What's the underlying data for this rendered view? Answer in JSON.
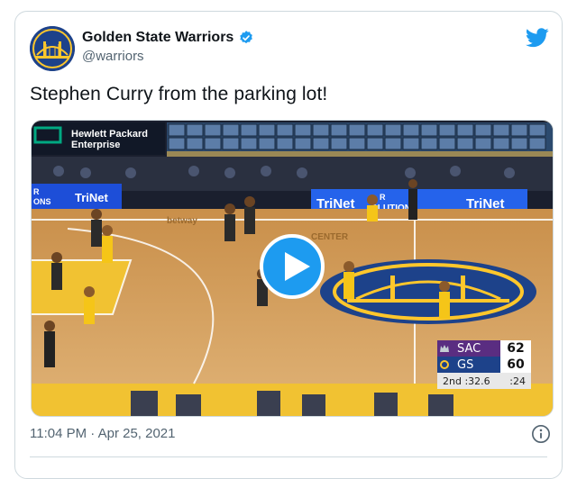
{
  "tweet": {
    "author_name": "Golden State Warriors",
    "handle": "@warriors",
    "verified": true,
    "text": "Stephen Curry from the parking lot!",
    "timestamp": "11:04 PM · Apr 25, 2021"
  },
  "media": {
    "type": "video",
    "overlay": {
      "sponsor_line1": "Hewlett Packard",
      "sponsor_line2": "Enterprise",
      "board_left_a": "R",
      "board_left_b": "ONS",
      "board_left_brand": "TriNet",
      "board_mid_a": "TriNet",
      "board_mid_b": "R",
      "board_mid_c": "OLUTIONS",
      "board_right": "TriNet",
      "floor_left": "betway",
      "floor_center": "CENTER"
    },
    "scoreboard": {
      "team1": "SAC",
      "score1": "62",
      "team2": "GS",
      "score2": "60",
      "period": "2nd",
      "clock": ":32.6",
      "shot_clock": ":24"
    }
  },
  "colors": {
    "accent": "#1d9bf0",
    "warriors_blue": "#1d428a",
    "warriors_gold": "#ffc72c",
    "kings_purple": "#5a2d81",
    "secondary_text": "#536471",
    "border": "#cfd9de"
  },
  "icons": {
    "verified": "verified-badge-icon",
    "bird": "twitter-bird-icon",
    "play": "play-icon",
    "info": "info-icon",
    "avatar": "warriors-logo"
  }
}
